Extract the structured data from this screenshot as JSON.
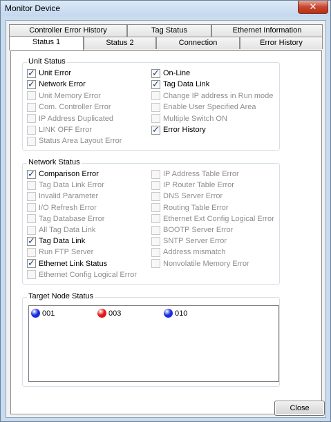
{
  "window": {
    "title": "Monitor Device",
    "close_glyph": "✕"
  },
  "tabs_back": [
    {
      "label": "Controller Error History"
    },
    {
      "label": "Tag Status"
    },
    {
      "label": "Ethernet Information"
    }
  ],
  "tabs_front": [
    {
      "label": "Status 1"
    },
    {
      "label": "Status 2"
    },
    {
      "label": "Connection"
    },
    {
      "label": "Error History"
    }
  ],
  "unit_status": {
    "title": "Unit Status",
    "left": [
      {
        "label": "Unit Error",
        "checked": true,
        "enabled": true
      },
      {
        "label": "Network Error",
        "checked": true,
        "enabled": true
      },
      {
        "label": "Unit Memory Error",
        "checked": false,
        "enabled": false
      },
      {
        "label": "Com. Controller Error",
        "checked": false,
        "enabled": false
      },
      {
        "label": "IP Address Duplicated",
        "checked": false,
        "enabled": false
      },
      {
        "label": "LINK OFF Error",
        "checked": false,
        "enabled": false
      },
      {
        "label": "Status Area Layout Error",
        "checked": false,
        "enabled": false
      }
    ],
    "right": [
      {
        "label": "On-Line",
        "checked": true,
        "enabled": true
      },
      {
        "label": "Tag Data Link",
        "checked": true,
        "enabled": true
      },
      {
        "label": "Change IP address in Run mode",
        "checked": false,
        "enabled": false
      },
      {
        "label": "Enable User Specified Area",
        "checked": false,
        "enabled": false
      },
      {
        "label": "Multiple Switch ON",
        "checked": false,
        "enabled": false
      },
      {
        "label": "Error History",
        "checked": true,
        "enabled": true
      }
    ]
  },
  "network_status": {
    "title": "Network Status",
    "left": [
      {
        "label": "Comparison Error",
        "checked": true,
        "enabled": true
      },
      {
        "label": "Tag Data Link Error",
        "checked": false,
        "enabled": false
      },
      {
        "label": "Invalid Parameter",
        "checked": false,
        "enabled": false
      },
      {
        "label": "I/O Refresh Error",
        "checked": false,
        "enabled": false
      },
      {
        "label": "Tag Database Error",
        "checked": false,
        "enabled": false
      },
      {
        "label": "All Tag Data Link",
        "checked": false,
        "enabled": false
      },
      {
        "label": "Tag Data Link",
        "checked": true,
        "enabled": true
      },
      {
        "label": "Run FTP Server",
        "checked": false,
        "enabled": false
      },
      {
        "label": "Ethernet Link Status",
        "checked": true,
        "enabled": true
      },
      {
        "label": "Ethernet Config Logical Error",
        "checked": false,
        "enabled": false
      }
    ],
    "right": [
      {
        "label": "IP Address Table Error",
        "checked": false,
        "enabled": false
      },
      {
        "label": "IP Router Table Error",
        "checked": false,
        "enabled": false
      },
      {
        "label": "DNS Server Error",
        "checked": false,
        "enabled": false
      },
      {
        "label": "Routing Table Error",
        "checked": false,
        "enabled": false
      },
      {
        "label": "Ethernet Ext Config Logical Error",
        "checked": false,
        "enabled": false
      },
      {
        "label": "BOOTP Server Error",
        "checked": false,
        "enabled": false
      },
      {
        "label": "SNTP Server Error",
        "checked": false,
        "enabled": false
      },
      {
        "label": "Address mismatch",
        "checked": false,
        "enabled": false
      },
      {
        "label": "Nonvolatile Memory Error",
        "checked": false,
        "enabled": false
      }
    ]
  },
  "target_node_status": {
    "title": "Target Node Status",
    "nodes": [
      {
        "label": "001",
        "color": "#1a2ee0"
      },
      {
        "label": "003",
        "color": "#e01818"
      },
      {
        "label": "010",
        "color": "#1a2ee0"
      }
    ]
  },
  "close_button": {
    "label": "Close"
  },
  "check_glyph": "✓"
}
